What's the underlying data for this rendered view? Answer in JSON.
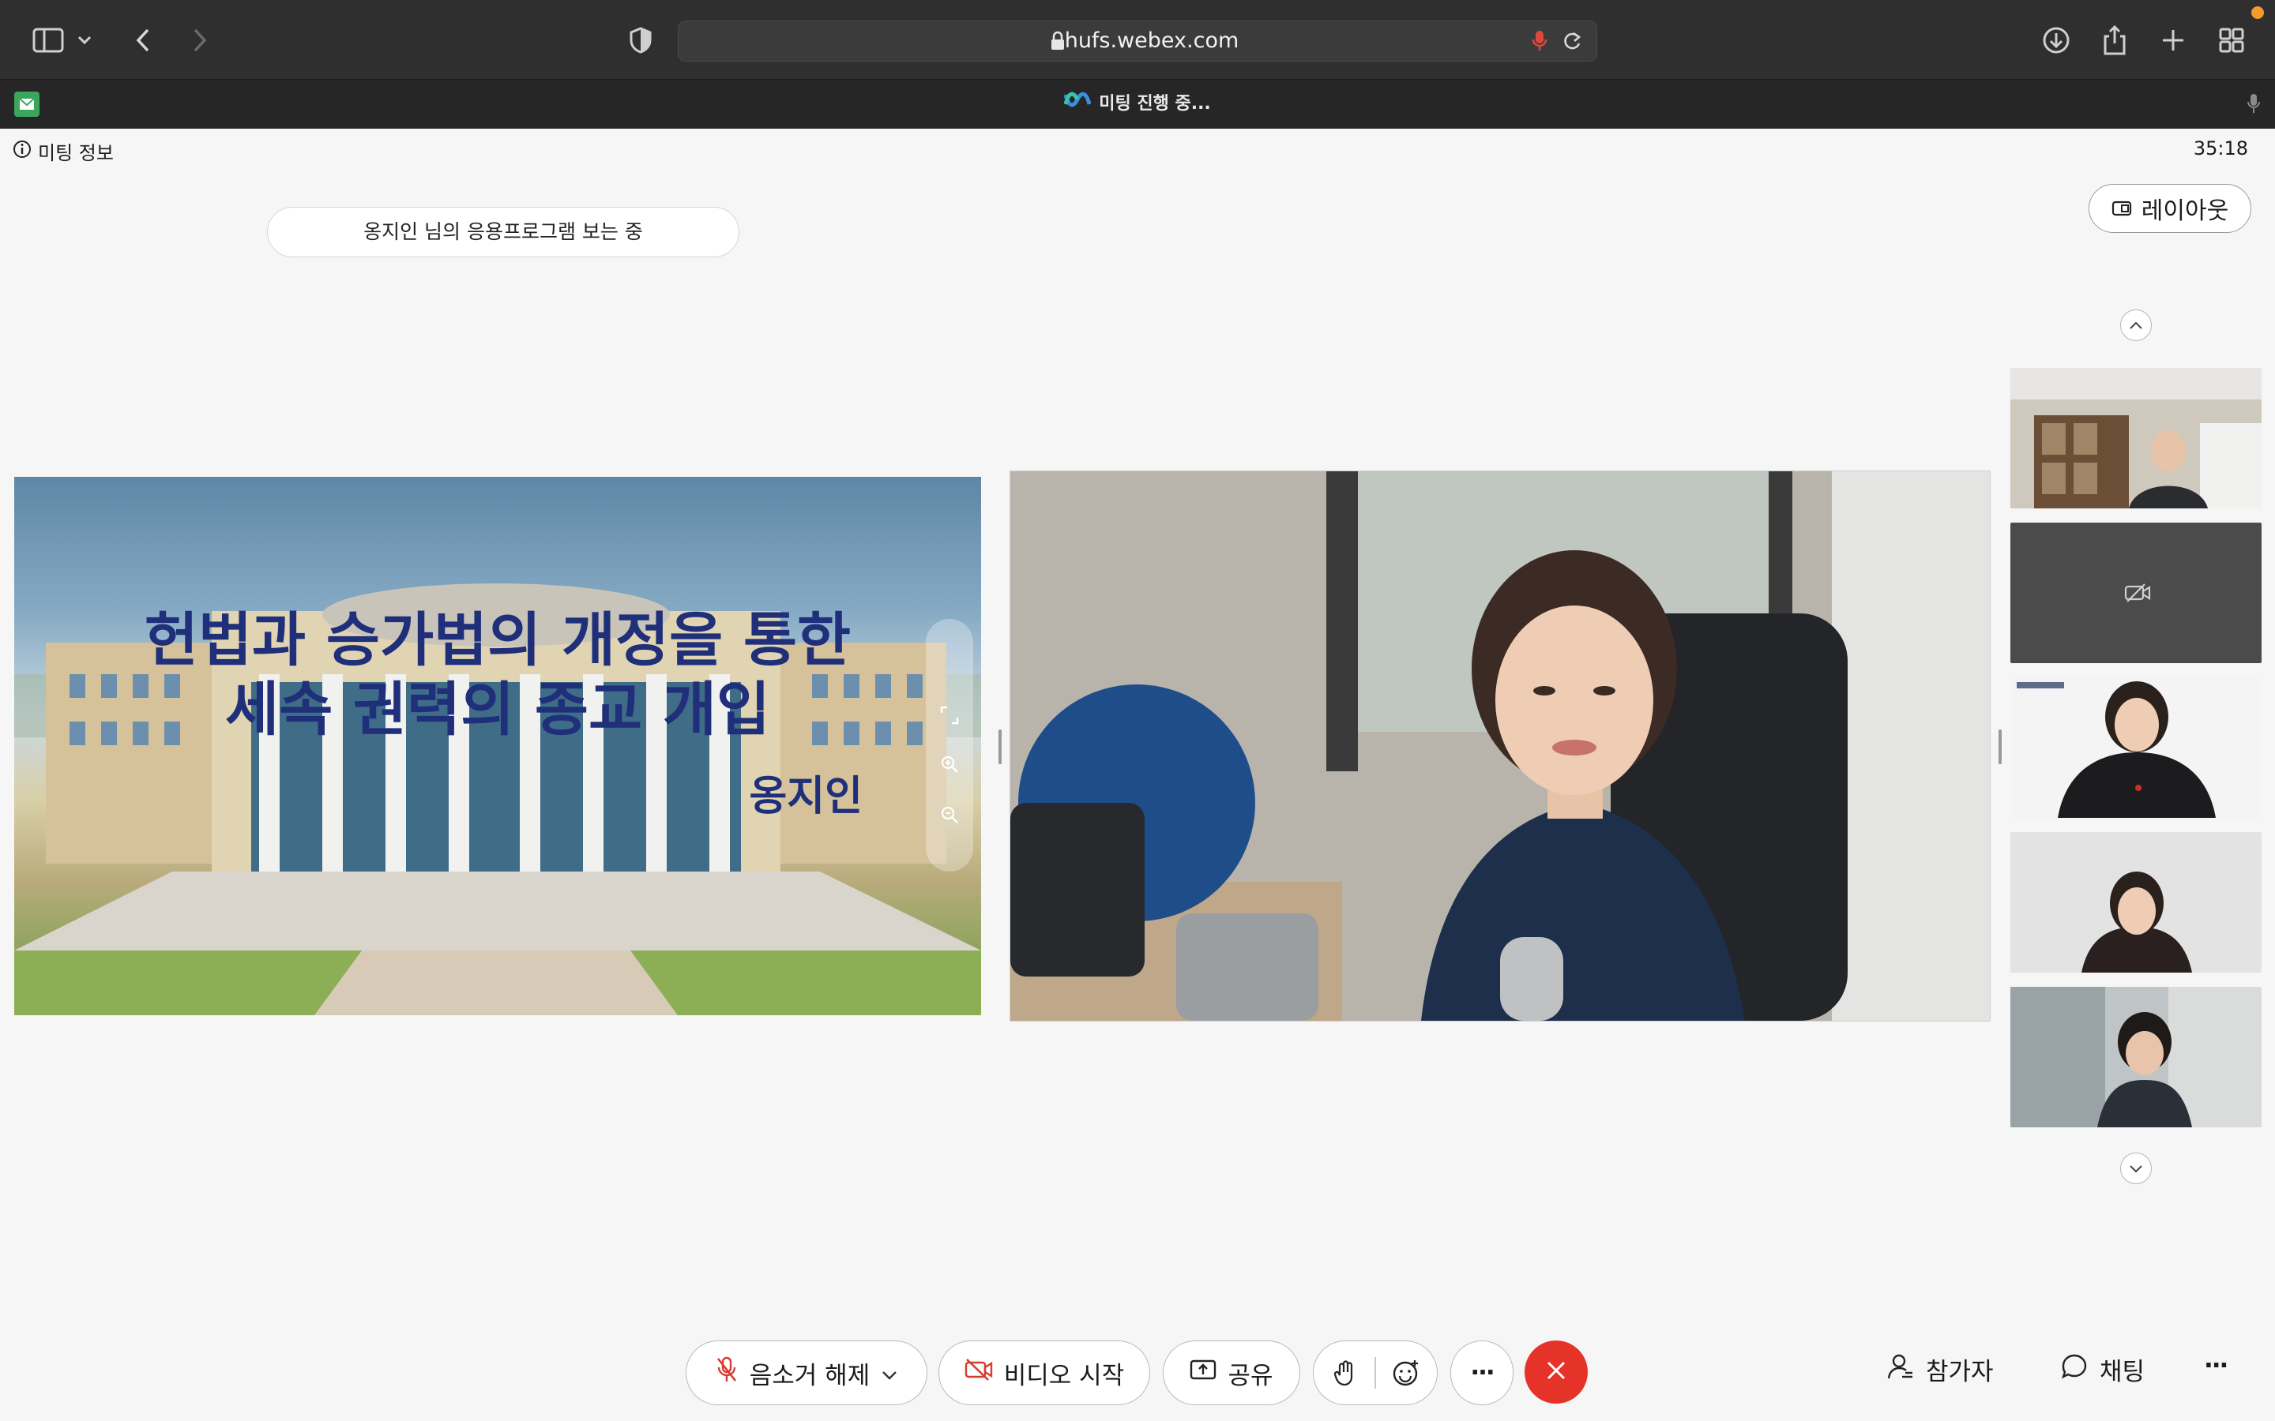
{
  "browser": {
    "url": "hufs.webex.com",
    "tab_title": "미팅 진행 중..."
  },
  "meeting": {
    "info_label": "미팅 정보",
    "elapsed_time": "35:18",
    "viewing_banner": "옹지인 님의 응용프로그램 보는 중",
    "layout_label": "레이아웃"
  },
  "shared_slide": {
    "title_line1": "헌법과 승가법의 개정을 통한",
    "title_line2": "세속 권력의 종교 개입",
    "author": "옹지인"
  },
  "controls": {
    "mute_label": "음소거 해제",
    "video_label": "비디오 시작",
    "share_label": "공유",
    "more_label": "···",
    "participants_label": "참가자",
    "chat_label": "채팅",
    "overflow_label": "···"
  },
  "colors": {
    "end_call": "#e5332a",
    "slide_text": "#1f2f7a",
    "muted_icon": "#d63b2f"
  }
}
